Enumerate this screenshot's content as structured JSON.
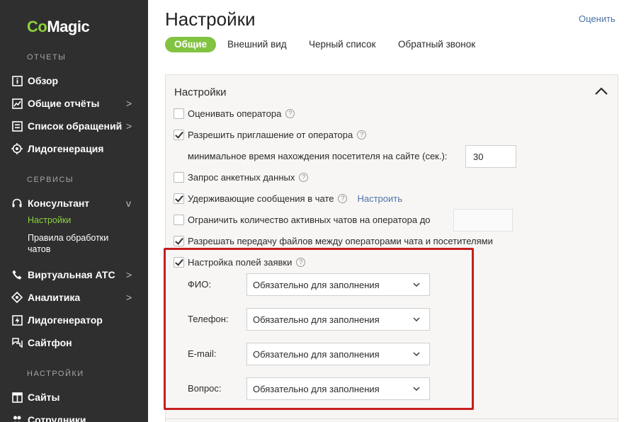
{
  "sidebar": {
    "logo_part1": "Co",
    "logo_part2": "Magic",
    "sections": {
      "reports": "ОТЧЕТЫ",
      "services": "СЕРВИСЫ",
      "settings": "НАСТРОЙКИ"
    },
    "items": {
      "overview": "Обзор",
      "general_reports": "Общие отчёты",
      "requests_list": "Список обращений",
      "leadgen": "Лидогенерация",
      "consultant": "Консультант",
      "consultant_settings": "Настройки",
      "processing_rules_line1": "Правила обработки",
      "processing_rules_line2": "чатов",
      "virtual_pbx": "Виртуальная АТС",
      "analytics": "Аналитика",
      "leadgenerator": "Лидогенератор",
      "sitephone": "Сайтфон",
      "sites": "Сайты",
      "employees": "Сотрудники"
    },
    "chevron_right": ">",
    "chevron_down": "v"
  },
  "header": {
    "title": "Настройки",
    "rate_link": "Оценить",
    "tabs": [
      "Общие",
      "Внешний вид",
      "Черный список",
      "Обратный звонок"
    ]
  },
  "panel": {
    "title": "Настройки",
    "options": {
      "rate_operator": "Оценивать оператора",
      "allow_invite": "Разрешить приглашение от оператора",
      "min_time_label": "минимальное время нахождения посетителя на сайте (сек.):",
      "min_time_value": "30",
      "request_form": "Запрос анкетных данных",
      "hold_messages": "Удерживающие сообщения в чате",
      "setup_link": "Настроить",
      "limit_chats": "Ограничить количество активных чатов на оператора до",
      "limit_chats_value": "",
      "file_transfer": "Разрешать передачу файлов между операторами чата и посетителями",
      "request_fields": "Настройка полей заявки"
    },
    "help_glyph": "?",
    "fields": [
      {
        "label": "ФИО:",
        "value": "Обязательно для заполнения"
      },
      {
        "label": "Телефон:",
        "value": "Обязательно для заполнения"
      },
      {
        "label": "E-mail:",
        "value": "Обязательно для заполнения"
      },
      {
        "label": "Вопрос:",
        "value": "Обязательно для заполнения"
      }
    ]
  },
  "colors": {
    "accent": "#82c341",
    "sidebar_bg": "#2f2f2f",
    "link": "#4a73a8",
    "highlight": "#c41f1f"
  }
}
